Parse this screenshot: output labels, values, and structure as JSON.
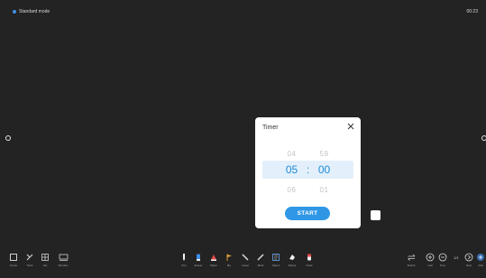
{
  "top_bar": {
    "mode_label": "Standard mode",
    "clock": "00:23"
  },
  "timer_dialog": {
    "title": "Timer",
    "minutes": {
      "above": "04",
      "selected": "05",
      "below": "06"
    },
    "seconds": {
      "above": "59",
      "selected": "00",
      "below": "01"
    },
    "separator": ":",
    "start_label": "START"
  },
  "toolbar": {
    "left": [
      {
        "name": "home",
        "label": "Home"
      },
      {
        "name": "tools",
        "label": "Tools"
      },
      {
        "name": "grid",
        "label": "Set"
      },
      {
        "name": "window",
        "label": "Window"
      }
    ],
    "center": [
      {
        "name": "pen",
        "label": "Pen"
      },
      {
        "name": "marker",
        "label": "Eraser"
      },
      {
        "name": "eraser",
        "label": "Wiper"
      },
      {
        "name": "flag",
        "label": "Bg"
      },
      {
        "name": "pencil",
        "label": "Lasso"
      },
      {
        "name": "brush",
        "label": "Mark"
      },
      {
        "name": "select",
        "label": "Select"
      },
      {
        "name": "stamp",
        "label": "Stamp"
      },
      {
        "name": "clear",
        "label": "Clear"
      }
    ],
    "right": [
      {
        "name": "switch",
        "label": "Switch"
      },
      {
        "name": "zoom-in",
        "label": "Last"
      },
      {
        "name": "zoom-out",
        "label": "Prev"
      },
      {
        "name": "page",
        "label": "1/1"
      },
      {
        "name": "next",
        "label": "Next"
      },
      {
        "name": "add",
        "label": "Add"
      }
    ]
  }
}
